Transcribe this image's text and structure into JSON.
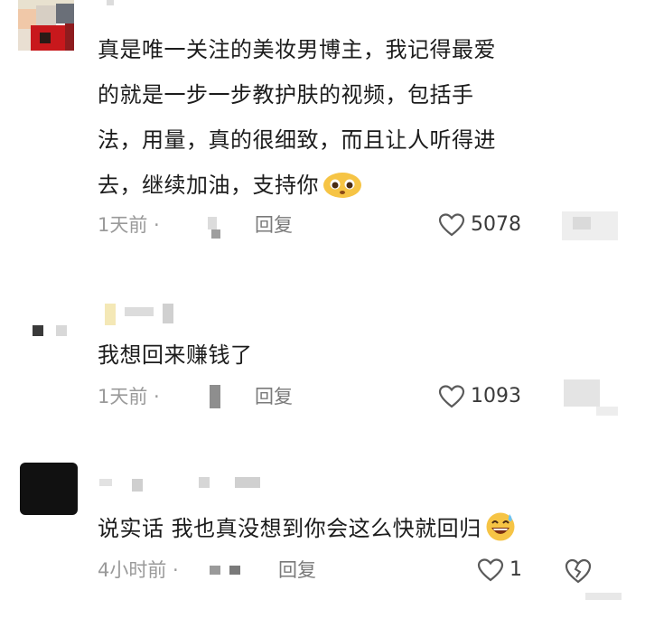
{
  "comments": [
    {
      "text_lines": [
        "真是唯一关注的美妆男博主，我记得最爱",
        "的就是一步一步教护肤的视频，包括手",
        "法，用量，真的很细致，而且让人听得进",
        "去，继续加油，支持你"
      ],
      "emoji": "pleading-face-emoji",
      "time": "1天前 ·",
      "reply_label": "回复",
      "like_count": "5078"
    },
    {
      "text_lines": [
        "我想回来赚钱了"
      ],
      "time": "1天前 ·",
      "reply_label": "回复",
      "like_count": "1093"
    },
    {
      "text_lines": [
        "说实话 我也真没想到你会这么快就回归"
      ],
      "emoji": "grinning-sweat-emoji",
      "time": "4小时前 ·",
      "reply_label": "回复",
      "like_count": "1"
    }
  ],
  "icons": {
    "like": "heart-outline-icon",
    "dislike": "broken-heart-icon"
  },
  "colors": {
    "text": "#1c1c1c",
    "meta": "#9a9a9a",
    "avatar1_red": "#c8181c",
    "avatar3": "#111111"
  }
}
